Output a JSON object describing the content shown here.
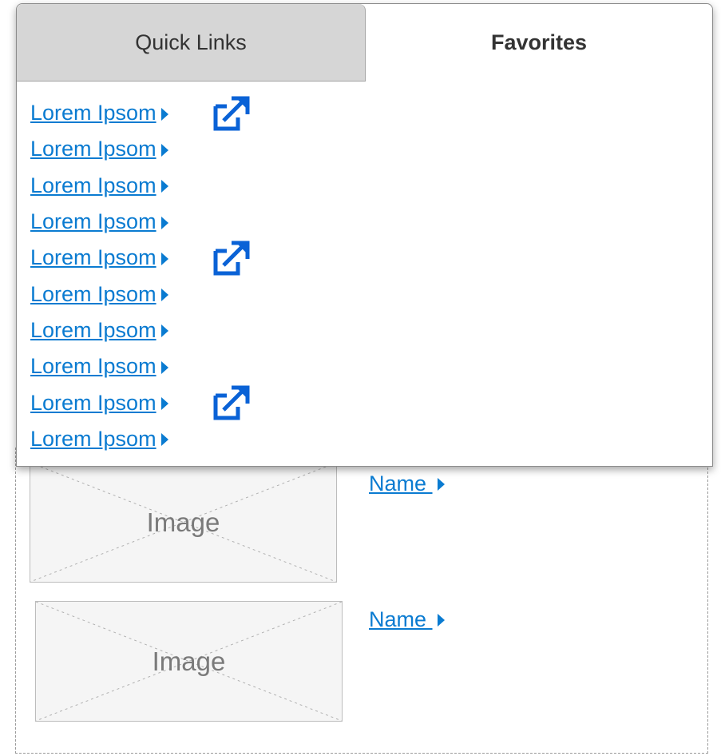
{
  "tabs": {
    "quick_links": "Quick Links",
    "favorites": "Favorites"
  },
  "links": [
    {
      "label": "Lorem Ipsom ",
      "external": true
    },
    {
      "label": "Lorem Ipsom ",
      "external": false
    },
    {
      "label": "Lorem Ipsom ",
      "external": false
    },
    {
      "label": "Lorem Ipsom ",
      "external": false
    },
    {
      "label": "Lorem Ipsom ",
      "external": true
    },
    {
      "label": "Lorem Ipsom ",
      "external": false
    },
    {
      "label": "Lorem Ipsom ",
      "external": false
    },
    {
      "label": "Lorem Ipsom ",
      "external": false
    },
    {
      "label": "Lorem Ipsom ",
      "external": true
    },
    {
      "label": "Lorem Ipsom ",
      "external": false
    }
  ],
  "cards": [
    {
      "image_label": "Image",
      "name": "Name "
    },
    {
      "image_label": "Image",
      "name": "Name "
    }
  ],
  "icons": {
    "caret": "caret-right-icon",
    "external": "external-link-icon"
  },
  "colors": {
    "link": "#0a7bd1",
    "external_icon": "#0a62d6",
    "tab_inactive_bg": "#d6d6d6",
    "placeholder_bg": "#f5f5f5"
  }
}
